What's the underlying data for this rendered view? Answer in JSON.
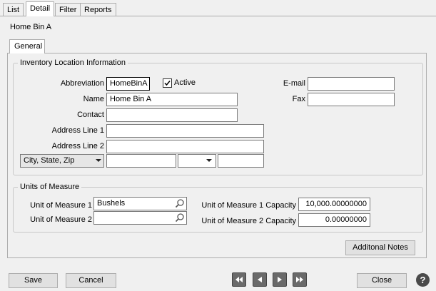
{
  "tabs": [
    "List",
    "Detail",
    "Filter",
    "Reports"
  ],
  "record_title": "Home Bin A",
  "inner_tab": "General",
  "location_group": {
    "legend": "Inventory Location Information",
    "abbreviation_label": "Abbreviation",
    "abbreviation_value": "HomeBinA",
    "active_label": "Active",
    "active_checked": true,
    "name_label": "Name",
    "name_value": "Home Bin A",
    "contact_label": "Contact",
    "contact_value": "",
    "address1_label": "Address Line 1",
    "address1_value": "",
    "address2_label": "Address Line 2",
    "address2_value": "",
    "city_state_zip_select": "City, State, Zip",
    "city_value": "",
    "state_value": "",
    "zip_value": "",
    "email_label": "E-mail",
    "email_value": "",
    "fax_label": "Fax",
    "fax_value": ""
  },
  "uom_group": {
    "legend": "Units of Measure",
    "uom1_label": "Unit of Measure 1",
    "uom1_value": "Bushels",
    "uom2_label": "Unit of Measure 2",
    "uom2_value": "",
    "uom1_cap_label": "Unit of Measure 1 Capacity",
    "uom1_cap_value": "10,000.00000000",
    "uom2_cap_label": "Unit of Measure 2 Capacity",
    "uom2_cap_value": "0.00000000"
  },
  "buttons": {
    "notes": "Additonal Notes",
    "save": "Save",
    "cancel": "Cancel",
    "close": "Close",
    "help": "?"
  },
  "icons": {
    "lookup": "magnifier-icon",
    "nav": [
      "first-record-icon",
      "previous-record-icon",
      "next-record-icon",
      "last-record-icon"
    ]
  },
  "colors": {
    "window_bg": "#f0f0f0",
    "nav_button": "#6a6a6a"
  }
}
